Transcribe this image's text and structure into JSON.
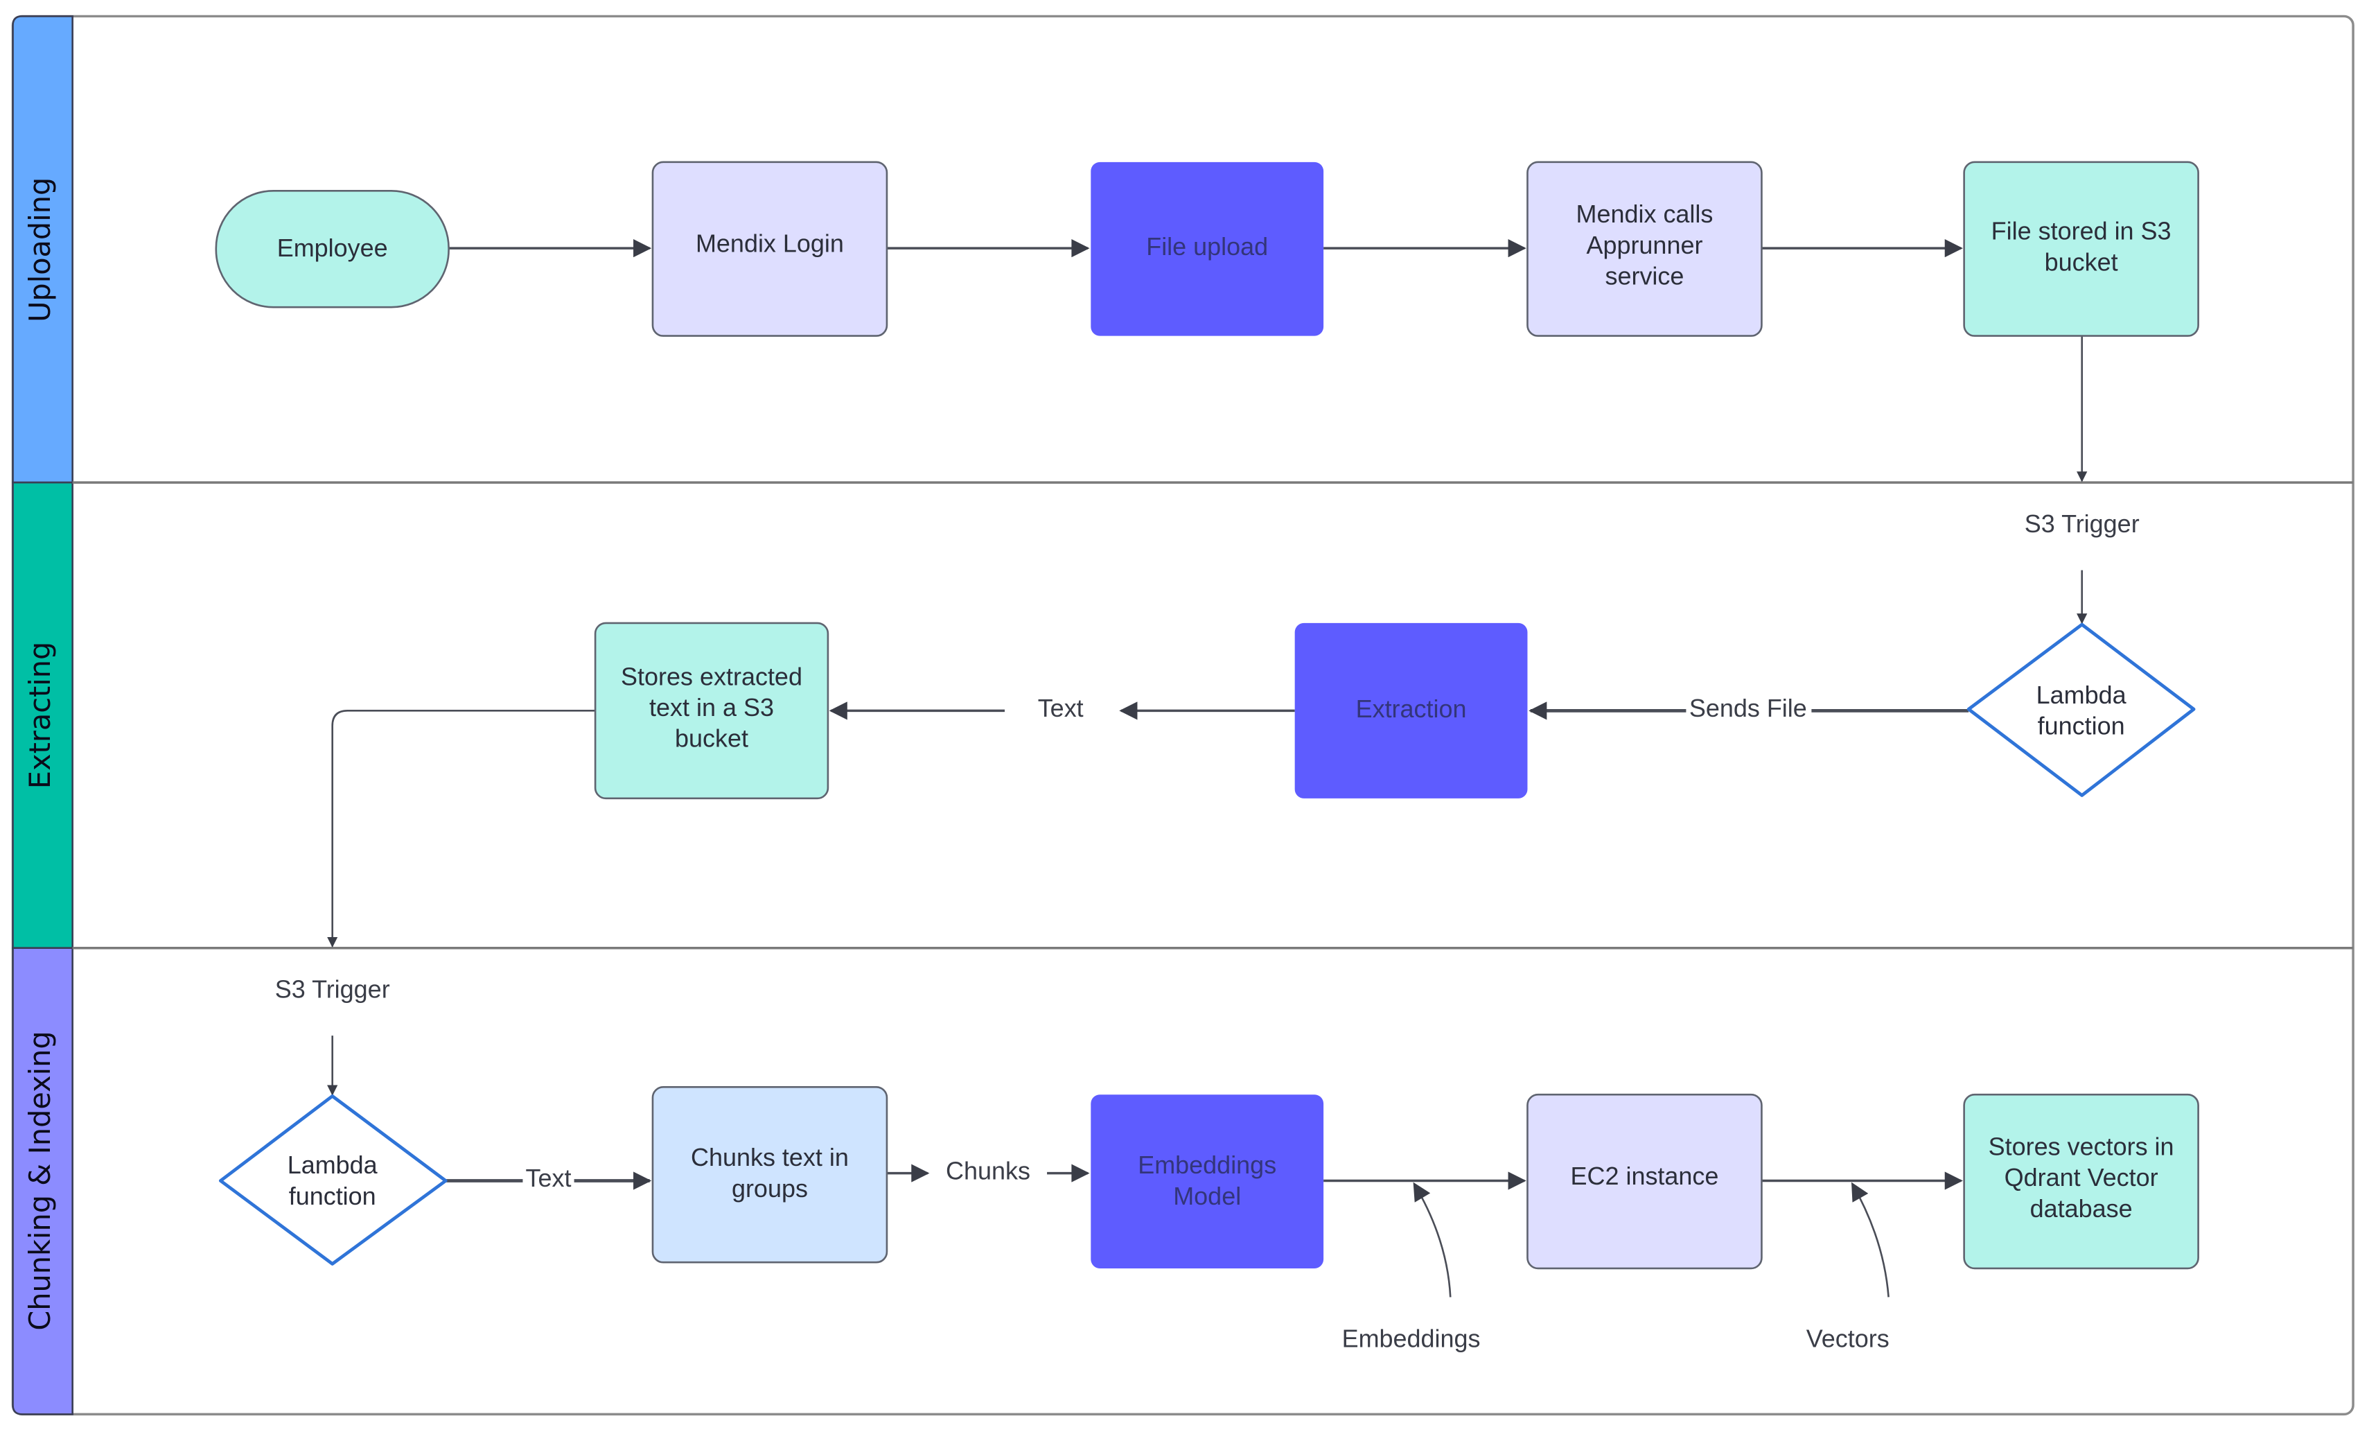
{
  "colors": {
    "lane_uploading": "#66AAFF",
    "lane_extracting": "#00BFA5",
    "lane_chunking": "#8C8CFF",
    "teal_box": "#B3F3EA",
    "lavender_box": "#DEDEFF",
    "primary_box": "#5E5CFF",
    "light_blue_box": "#CFE4FF",
    "decision_stroke": "#2F74D8"
  },
  "lanes": [
    {
      "id": "uploading",
      "label": "Uploading"
    },
    {
      "id": "extracting",
      "label": "Extracting"
    },
    {
      "id": "chunking",
      "label": "Chunking & Indexing"
    }
  ],
  "nodes": {
    "employee": {
      "lines": [
        "Employee"
      ],
      "shape": "terminator"
    },
    "mendix_login": {
      "lines": [
        "Mendix Login"
      ],
      "shape": "process"
    },
    "file_upload": {
      "lines": [
        "File upload"
      ],
      "shape": "process"
    },
    "mendix_calls": {
      "lines": [
        "Mendix calls",
        "Apprunner",
        "service"
      ],
      "shape": "process"
    },
    "file_stored": {
      "lines": [
        "File stored in S3",
        "bucket"
      ],
      "shape": "process"
    },
    "lambda_1": {
      "lines": [
        "Lambda",
        "function"
      ],
      "shape": "decision"
    },
    "extraction": {
      "lines": [
        "Extraction"
      ],
      "shape": "process"
    },
    "stores_extracted": {
      "lines": [
        "Stores extracted",
        "text in a S3",
        "bucket"
      ],
      "shape": "process"
    },
    "lambda_2": {
      "lines": [
        "Lambda",
        "function"
      ],
      "shape": "decision"
    },
    "chunks_text": {
      "lines": [
        "Chunks text in",
        "groups"
      ],
      "shape": "process"
    },
    "embeddings_model": {
      "lines": [
        "Embeddings",
        "Model"
      ],
      "shape": "process"
    },
    "ec2": {
      "lines": [
        "EC2 instance"
      ],
      "shape": "process"
    },
    "stores_vectors": {
      "lines": [
        "Stores vectors in",
        "Qdrant Vector",
        "database"
      ],
      "shape": "process"
    }
  },
  "edge_labels": {
    "s3_trigger_1": "S3 Trigger",
    "sends_file": "Sends File",
    "text_1": "Text",
    "s3_trigger_2": "S3 Trigger",
    "text_2": "Text",
    "chunks": "Chunks",
    "embeddings": "Embeddings",
    "vectors": "Vectors"
  }
}
